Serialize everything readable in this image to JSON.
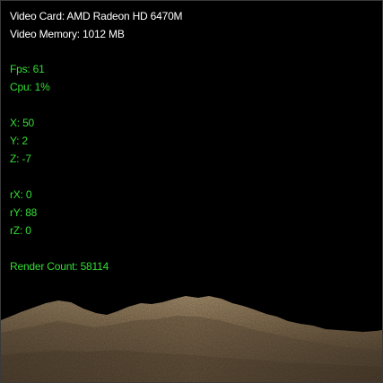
{
  "hud": {
    "video_card": "Video Card: AMD Radeon HD 6470M",
    "video_memory": "Video Memory: 1012 MB",
    "fps": "Fps: 61",
    "cpu": "Cpu: 1%",
    "pos_x": "X: 50",
    "pos_y": "Y: 2",
    "pos_z": "Z: -7",
    "rot_x": "rX: 0",
    "rot_y": "rY: 88",
    "rot_z": "rZ: 0",
    "render_count": "Render Count: 58114"
  },
  "colors": {
    "background": "#000000",
    "info_text": "#ffffff",
    "stats_text": "#33dd33",
    "terrain_light": "#a08a6c",
    "terrain_dark": "#5c4c38"
  }
}
